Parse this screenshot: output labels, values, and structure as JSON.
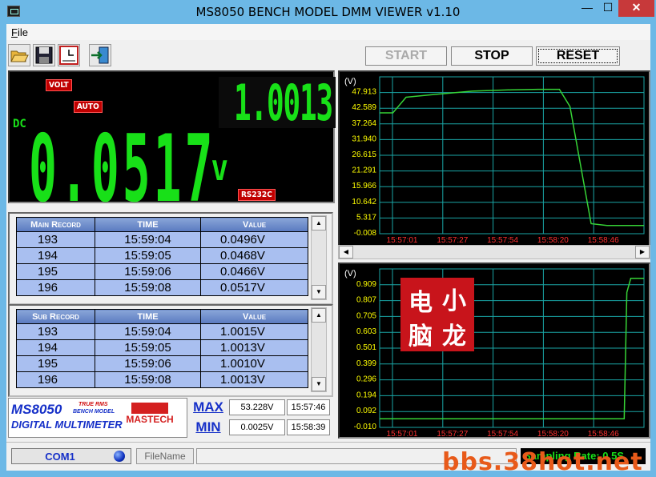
{
  "window": {
    "title": "MS8050 BENCH MODEL DMM VIEWER v1.10",
    "min_glyph": "—",
    "max_glyph": "☐",
    "close_glyph": "✕"
  },
  "menu": {
    "file": "File"
  },
  "toolbar": {
    "open_icon": "open-folder-icon",
    "save_icon": "floppy-save-icon",
    "time_icon": "clock-chart-icon",
    "exit_icon": "exit-door-icon"
  },
  "controls": {
    "start": "START",
    "stop": "STOP",
    "reset": "RESET"
  },
  "display": {
    "volt_badge": "VOLT",
    "auto_badge": "AUTO",
    "dc_label": "DC",
    "sub_reading": "1.0013",
    "main_reading": "0.0517",
    "main_unit": "V",
    "rs232c_badge": "RS232C"
  },
  "main_record": {
    "headers": [
      "Main Record",
      "TIME",
      "Value"
    ],
    "rows": [
      [
        "193",
        "15:59:04",
        "0.0496V"
      ],
      [
        "194",
        "15:59:05",
        "0.0468V"
      ],
      [
        "195",
        "15:59:06",
        "0.0466V"
      ],
      [
        "196",
        "15:59:08",
        "0.0517V"
      ]
    ]
  },
  "sub_record": {
    "headers": [
      "Sub Record",
      "TIME",
      "Value"
    ],
    "rows": [
      [
        "193",
        "15:59:04",
        "1.0015V"
      ],
      [
        "194",
        "15:59:05",
        "1.0013V"
      ],
      [
        "195",
        "15:59:06",
        "1.0010V"
      ],
      [
        "196",
        "15:59:08",
        "1.0013V"
      ]
    ]
  },
  "brand": {
    "model": "MS8050",
    "true_rms": "TRUE RMS",
    "bench_model": "BENCH MODEL",
    "digital_multimeter": "DIGITAL MULTIMETER",
    "maker": "MASTECH"
  },
  "stats": {
    "max_label": "MAX",
    "max_value": "53.228V",
    "max_time": "15:57:46",
    "min_label": "MIN",
    "min_value": "0.0025V",
    "min_time": "15:58:39"
  },
  "status": {
    "com_port": "COM1",
    "filename_button": "FileName",
    "sampling_rate": "Sampling Rate: 0.5S"
  },
  "watermark": "bbs.38hot.net",
  "seal": [
    "电",
    "小",
    "脑",
    "龙"
  ],
  "colors": {
    "trace": "#36d236",
    "grid": "#1aa6a6",
    "tick_text": "#ffff00",
    "time_text": "#ff3030"
  },
  "chart_data": [
    {
      "type": "line",
      "ylabel": "(V)",
      "yticks": [
        "47.913",
        "42.589",
        "37.264",
        "31.940",
        "26.615",
        "21.291",
        "15.966",
        "10.642",
        "5.317",
        "-0.008"
      ],
      "xticks": [
        "15:57:01",
        "15:57:27",
        "15:57:54",
        "15:58:20",
        "15:58:46"
      ],
      "ylim": [
        -0.008,
        53.238
      ],
      "grid": true,
      "series": [
        {
          "values": [
            [
              0.0,
              42.6
            ],
            [
              0.05,
              42.6
            ],
            [
              0.1,
              48.5
            ],
            [
              0.2,
              49.5
            ],
            [
              0.35,
              50.8
            ],
            [
              0.5,
              51.3
            ],
            [
              0.6,
              51.5
            ],
            [
              0.68,
              51.5
            ],
            [
              0.72,
              45.0
            ],
            [
              0.8,
              0.8
            ],
            [
              0.86,
              0.1
            ],
            [
              1.0,
              0.1
            ]
          ]
        }
      ]
    },
    {
      "type": "line",
      "ylabel": "(V)",
      "yticks": [
        "0.909",
        "0.807",
        "0.705",
        "0.603",
        "0.501",
        "0.399",
        "0.296",
        "0.194",
        "0.092",
        "-0.010"
      ],
      "xticks": [
        "15:57:01",
        "15:57:27",
        "15:57:54",
        "15:58:20",
        "15:58:46"
      ],
      "ylim": [
        -0.01,
        1.011
      ],
      "grid": true,
      "series": [
        {
          "values": [
            [
              0.0,
              -0.005
            ],
            [
              0.925,
              -0.005
            ],
            [
              0.935,
              0.9
            ],
            [
              0.95,
              1.0
            ],
            [
              1.0,
              1.0
            ]
          ]
        }
      ]
    }
  ]
}
